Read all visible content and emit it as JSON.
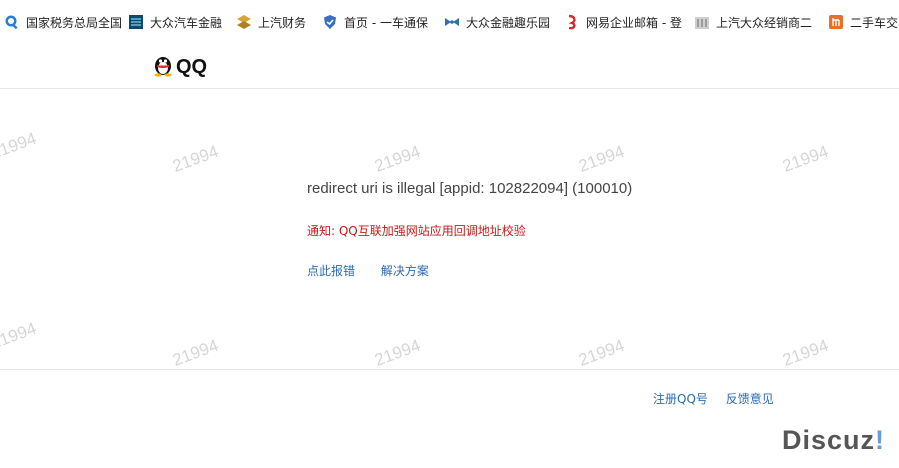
{
  "bookmarks": [
    {
      "label": "国家税务总局全国",
      "icon": "search-globe-icon"
    },
    {
      "label": "大众汽车金融",
      "icon": "vw-finance-icon"
    },
    {
      "label": "上汽财务",
      "icon": "saic-finance-icon"
    },
    {
      "label": "首页 - 一车通保",
      "icon": "shield-icon"
    },
    {
      "label": "大众金融趣乐园",
      "icon": "bowtie-icon"
    },
    {
      "label": "网易企业邮箱 - 登",
      "icon": "netease-mail-icon"
    },
    {
      "label": "上汽大众经销商二",
      "icon": "building-icon"
    },
    {
      "label": "二手车交易",
      "icon": "auction-icon"
    }
  ],
  "header": {
    "logo_text": "QQ"
  },
  "main": {
    "error_title": "redirect uri is illegal [appid: 102822094] (100010)",
    "notice": "通知: QQ互联加强网站应用回调地址校验",
    "links": [
      "点此报错",
      "解决方案"
    ]
  },
  "footer": {
    "links": [
      "注册QQ号",
      "反馈意见"
    ]
  },
  "watermark": "21994",
  "discuz": {
    "name": "Discuz",
    "mark": "!"
  }
}
